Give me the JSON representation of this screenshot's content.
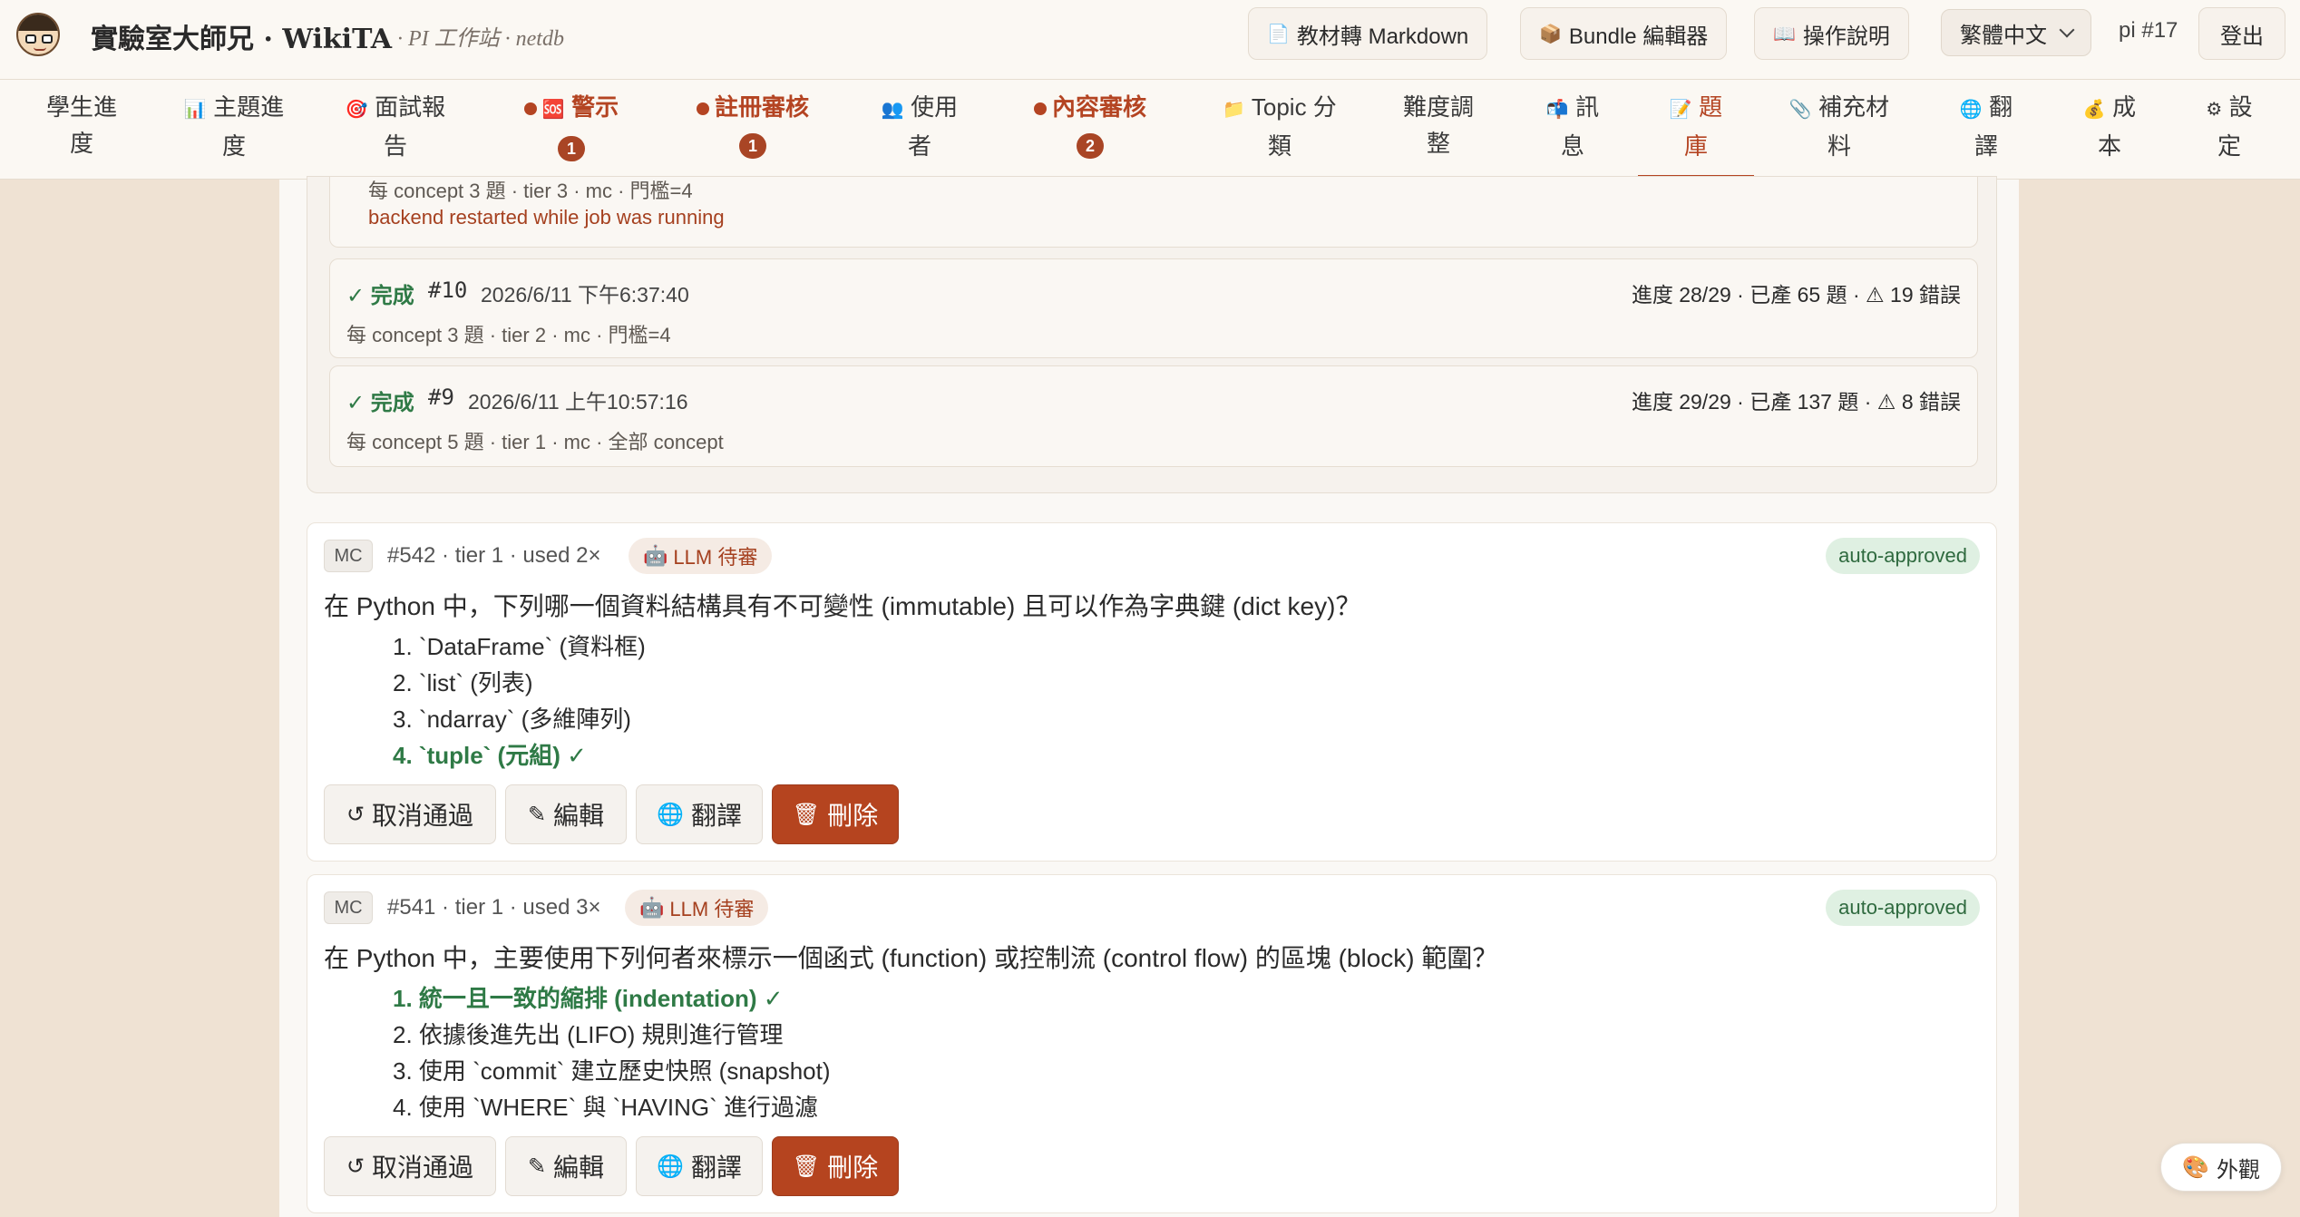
{
  "header": {
    "app_title": "實驗室大師兄 · WikiTA",
    "subtitle": "· PI 工作站 · netdb",
    "buttons": {
      "markdown": "教材轉 Markdown",
      "bundle": "Bundle 編輯器",
      "help": "操作說明"
    },
    "icons": {
      "markdown": "📄",
      "bundle": "📦",
      "help": "📖"
    },
    "language": "繁體中文",
    "user": "pi #17",
    "logout": "登出"
  },
  "nav": {
    "tabs": [
      {
        "line1": "學生進",
        "line2": "度"
      },
      {
        "icon": "📊",
        "line1": "主題進",
        "line2": "度"
      },
      {
        "icon": "🎯",
        "line1": "面試報",
        "line2": "告"
      },
      {
        "icon": "🆘",
        "line1": "警示",
        "badge": "1"
      },
      {
        "line1": "註冊審核",
        "badge": "1"
      },
      {
        "icon": "👥",
        "line1": "使用",
        "line2": "者"
      },
      {
        "line1": "內容審核",
        "badge": "2"
      },
      {
        "icon": "📁",
        "line1": "Topic 分",
        "line2": "類"
      },
      {
        "line1": "難度調",
        "line2": "整"
      },
      {
        "icon": "📬",
        "line1": "訊",
        "line2": "息"
      },
      {
        "icon": "📝",
        "line1": "題",
        "line2": "庫"
      },
      {
        "icon": "📎",
        "line1": "補充材",
        "line2": "料"
      },
      {
        "icon": "🌐",
        "line1": "翻",
        "line2": "譯"
      },
      {
        "icon": "💰",
        "line1": "成",
        "line2": "本"
      },
      {
        "icon": "⚙",
        "line1": "設",
        "line2": "定"
      }
    ],
    "active_tab": "題庫",
    "alert_color": "#b44422"
  },
  "jobs": {
    "partial": {
      "meta": "每 concept 3 題 · tier 3 · mc · 門檻=4",
      "error": "backend restarted while job was running"
    },
    "items": [
      {
        "status": "✓ 完成",
        "id": "#10",
        "time": "2026/6/11 下午6:37:40",
        "progress": "進度 28/29 · 已產 65 題 · ⚠ 19 錯誤",
        "meta": "每 concept 3 題 · tier 2 · mc · 門檻=4"
      },
      {
        "status": "✓ 完成",
        "id": "#9",
        "time": "2026/6/11 上午10:57:16",
        "progress": "進度 29/29 · 已產 137 題 · ⚠ 8 錯誤",
        "meta": "每 concept 5 題 · tier 1 · mc · 全部 concept"
      }
    ]
  },
  "questions": [
    {
      "type": "MC",
      "meta": "#542 · tier 1 · used 2×",
      "llm": "LLM 待審",
      "status": "auto-approved",
      "text": "在 Python 中，下列哪一個資料結構具有不可變性 (immutable) 且可以作為字典鍵 (dict key)？",
      "options": [
        "1. `DataFrame` (資料框)",
        "2. `list` (列表)",
        "3. `ndarray` (多維陣列)",
        "4. `tuple` (元組) ✓"
      ],
      "correct_index": 3
    },
    {
      "type": "MC",
      "meta": "#541 · tier 1 · used 3×",
      "llm": "LLM 待審",
      "status": "auto-approved",
      "text": "在 Python 中，主要使用下列何者來標示一個函式 (function) 或控制流 (control flow) 的區塊 (block) 範圍？",
      "options": [
        "1. 統一且一致的縮排 (indentation) ✓",
        "2. 依據後進先出 (LIFO) 規則進行管理",
        "3. 使用 `commit` 建立歷史快照 (snapshot)",
        "4. 使用 `WHERE` 與 `HAVING` 進行過濾"
      ],
      "correct_index": 0
    }
  ],
  "actions": {
    "unapprove": "取消通過",
    "edit": "編輯",
    "translate": "翻譯",
    "delete": "刪除"
  },
  "appearance": {
    "icon": "🎨",
    "label": "外觀"
  }
}
